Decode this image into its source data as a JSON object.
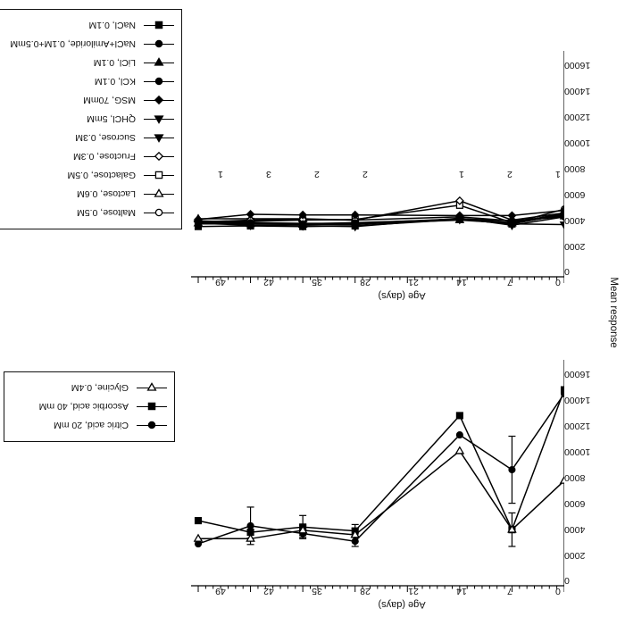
{
  "figure": {
    "orientation_note": "rotated-180",
    "y_axis_title": "Mean response",
    "x_axis_title": "Age (days)",
    "y_ticks": [
      "0",
      "2000",
      "4000",
      "6000",
      "8000",
      "10000",
      "12000",
      "14000",
      "16000"
    ],
    "x_ticks": [
      "0",
      "7",
      "14",
      "21",
      "28",
      "35",
      "42",
      "49"
    ]
  },
  "chart_data": [
    {
      "type": "line",
      "id": "panel-top",
      "title": "",
      "xlabel": "Age (days)",
      "ylabel": "Mean response",
      "xlim": [
        0,
        49
      ],
      "ylim": [
        0,
        16000
      ],
      "grid": false,
      "legend_position": "right",
      "x": [
        0,
        7,
        14,
        21,
        28,
        35,
        42,
        49
      ],
      "series": [
        {
          "name": "Citric acid, 20 mM",
          "marker": "filled-circle",
          "values": [
            14900,
            9000,
            11700,
            3450,
            4050,
            4650,
            3250
          ],
          "x": [
            0,
            7,
            14,
            28,
            35,
            42,
            49
          ],
          "errors": [
            0,
            2600,
            0,
            400,
            300,
            1450,
            0
          ]
        },
        {
          "name": "Ascorbic acid, 40 mM",
          "marker": "filled-square",
          "values": [
            15200,
            4350,
            13200,
            4250,
            4550,
            4150,
            5050
          ],
          "x": [
            0,
            7,
            14,
            28,
            35,
            42,
            49
          ],
          "errors": [
            0,
            1300,
            0,
            500,
            900,
            450,
            0
          ]
        },
        {
          "name": "Glycine, 0.4M",
          "marker": "open-down-triangle",
          "values": [
            8150,
            4350,
            10450,
            3950,
            4300,
            3650,
            3650
          ],
          "x": [
            0,
            7,
            14,
            28,
            35,
            42,
            49
          ],
          "errors": [
            0,
            0,
            0,
            500,
            400,
            0,
            0
          ]
        }
      ]
    },
    {
      "type": "line",
      "id": "panel-bottom",
      "title": "",
      "xlabel": "Age (days)",
      "ylabel": "Mean response",
      "xlim": [
        0,
        49
      ],
      "ylim": [
        0,
        16000
      ],
      "grid": false,
      "legend_position": "right",
      "x": [
        0,
        7,
        14,
        28,
        35,
        42,
        49
      ],
      "annotations": [
        {
          "label": "1",
          "x": 0
        },
        {
          "label": "2",
          "x": 7
        },
        {
          "label": "1",
          "x": 14
        },
        {
          "label": "2",
          "x": 28
        },
        {
          "label": "2",
          "x": 35
        },
        {
          "label": "3",
          "x": 42
        },
        {
          "label": "1",
          "x": 49
        }
      ],
      "series": [
        {
          "name": "Maltose, 0.5M",
          "marker": "open-circle",
          "values": [
            5250,
            4150,
            4500,
            4150,
            4150,
            4200,
            4350
          ]
        },
        {
          "name": "Lactose, 0.6M",
          "marker": "open-down-triangle",
          "values": [
            4700,
            4350,
            4650,
            4400,
            4500,
            4500,
            4500
          ]
        },
        {
          "name": "Galactose, 0.5M",
          "marker": "open-square",
          "values": [
            4900,
            4200,
            5550,
            4450,
            4400,
            4300,
            4200
          ]
        },
        {
          "name": "Fructose, 0.3M",
          "marker": "open-diamond",
          "values": [
            4950,
            4400,
            5900,
            4400,
            4450,
            4400,
            4250
          ]
        },
        {
          "name": "Sucrose, 0.3M",
          "marker": "filled-up-triangle",
          "values": [
            4050,
            4100,
            4450,
            4200,
            4100,
            4150,
            4100
          ]
        },
        {
          "name": "QHCl, 5mM",
          "marker": "filled-up-triangle",
          "values": [
            4650,
            4000,
            4550,
            3900,
            3950,
            4000,
            4150
          ]
        },
        {
          "name": "MSG, 70mM",
          "marker": "filled-diamond",
          "values": [
            5150,
            4750,
            4750,
            4800,
            4800,
            4850,
            4450
          ]
        },
        {
          "name": "KCl, 0.1M",
          "marker": "filled-circle",
          "values": [
            4900,
            4200,
            4500,
            4050,
            4050,
            4200,
            4150
          ]
        },
        {
          "name": "LiCl, 0.1M",
          "marker": "filled-down-triangle",
          "values": [
            4800,
            4150,
            4400,
            4100,
            4050,
            4100,
            4150
          ]
        },
        {
          "name": "NaCl+Amiloride, 0.1M+0.5mM",
          "marker": "filled-circle",
          "values": [
            4650,
            4350,
            4500,
            4100,
            4050,
            4100,
            4100
          ]
        },
        {
          "name": "NaCl, 0.1M",
          "marker": "filled-square",
          "values": [
            4850,
            4100,
            4450,
            3950,
            3900,
            3950,
            3900
          ]
        }
      ]
    }
  ],
  "legend_top": {
    "items": [
      {
        "label": "Citric acid, 20 mM",
        "marker": "filled-circle"
      },
      {
        "label": "Ascorbic acid, 40 mM",
        "marker": "filled-square"
      },
      {
        "label": "Glycine, 0.4M",
        "marker": "open-down-triangle"
      }
    ]
  },
  "legend_bottom": {
    "items": [
      {
        "label": "Maltose, 0.5M",
        "marker": "open-circle"
      },
      {
        "label": "Lactose, 0.6M",
        "marker": "open-down-triangle"
      },
      {
        "label": "Galactose, 0.5M",
        "marker": "open-square"
      },
      {
        "label": "Fructose, 0.3M",
        "marker": "open-diamond"
      },
      {
        "label": "Sucrose, 0.3M",
        "marker": "filled-up-triangle"
      },
      {
        "label": "QHCl, 5mM",
        "marker": "filled-up-triangle"
      },
      {
        "label": "MSG, 70mM",
        "marker": "filled-diamond"
      },
      {
        "label": "KCl, 0.1M",
        "marker": "filled-circle"
      },
      {
        "label": "LiCl, 0.1M",
        "marker": "filled-down-triangle"
      },
      {
        "label": "NaCl+Amiloride, 0.1M+0.5mM",
        "marker": "filled-circle"
      },
      {
        "label": "NaCl, 0.1M",
        "marker": "filled-square"
      }
    ]
  }
}
